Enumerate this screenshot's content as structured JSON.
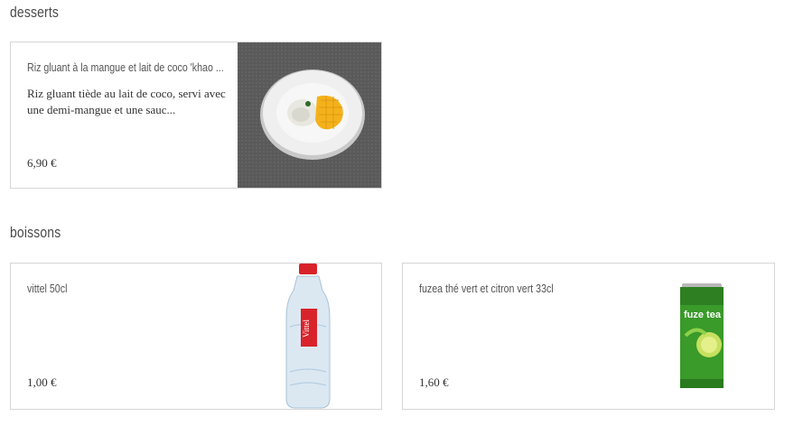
{
  "sections": [
    {
      "title": "desserts",
      "items": [
        {
          "name": "Riz gluant à la mangue et lait de coco 'khao ...",
          "description": "Riz gluant tiède au lait de coco, servi avec une demi-mangue et une sauc...",
          "price": "6,90 €",
          "image": "mango-sticky-rice-plate"
        }
      ]
    },
    {
      "title": "boissons",
      "items": [
        {
          "name": "vittel 50cl",
          "price": "1,00 €",
          "image": "vittel-water-bottle",
          "image_text": "Vittel"
        },
        {
          "name": "fuzea thé vert et citron vert 33cl",
          "price": "1,60 €",
          "image": "fuzetea-can",
          "image_text": "fuze tea"
        }
      ]
    }
  ],
  "colors": {
    "card_border": "#d6d6d6",
    "photo_bg": "#5a5a5a",
    "vittel_red": "#d8232a",
    "fuze_green": "#3a9a2a"
  }
}
